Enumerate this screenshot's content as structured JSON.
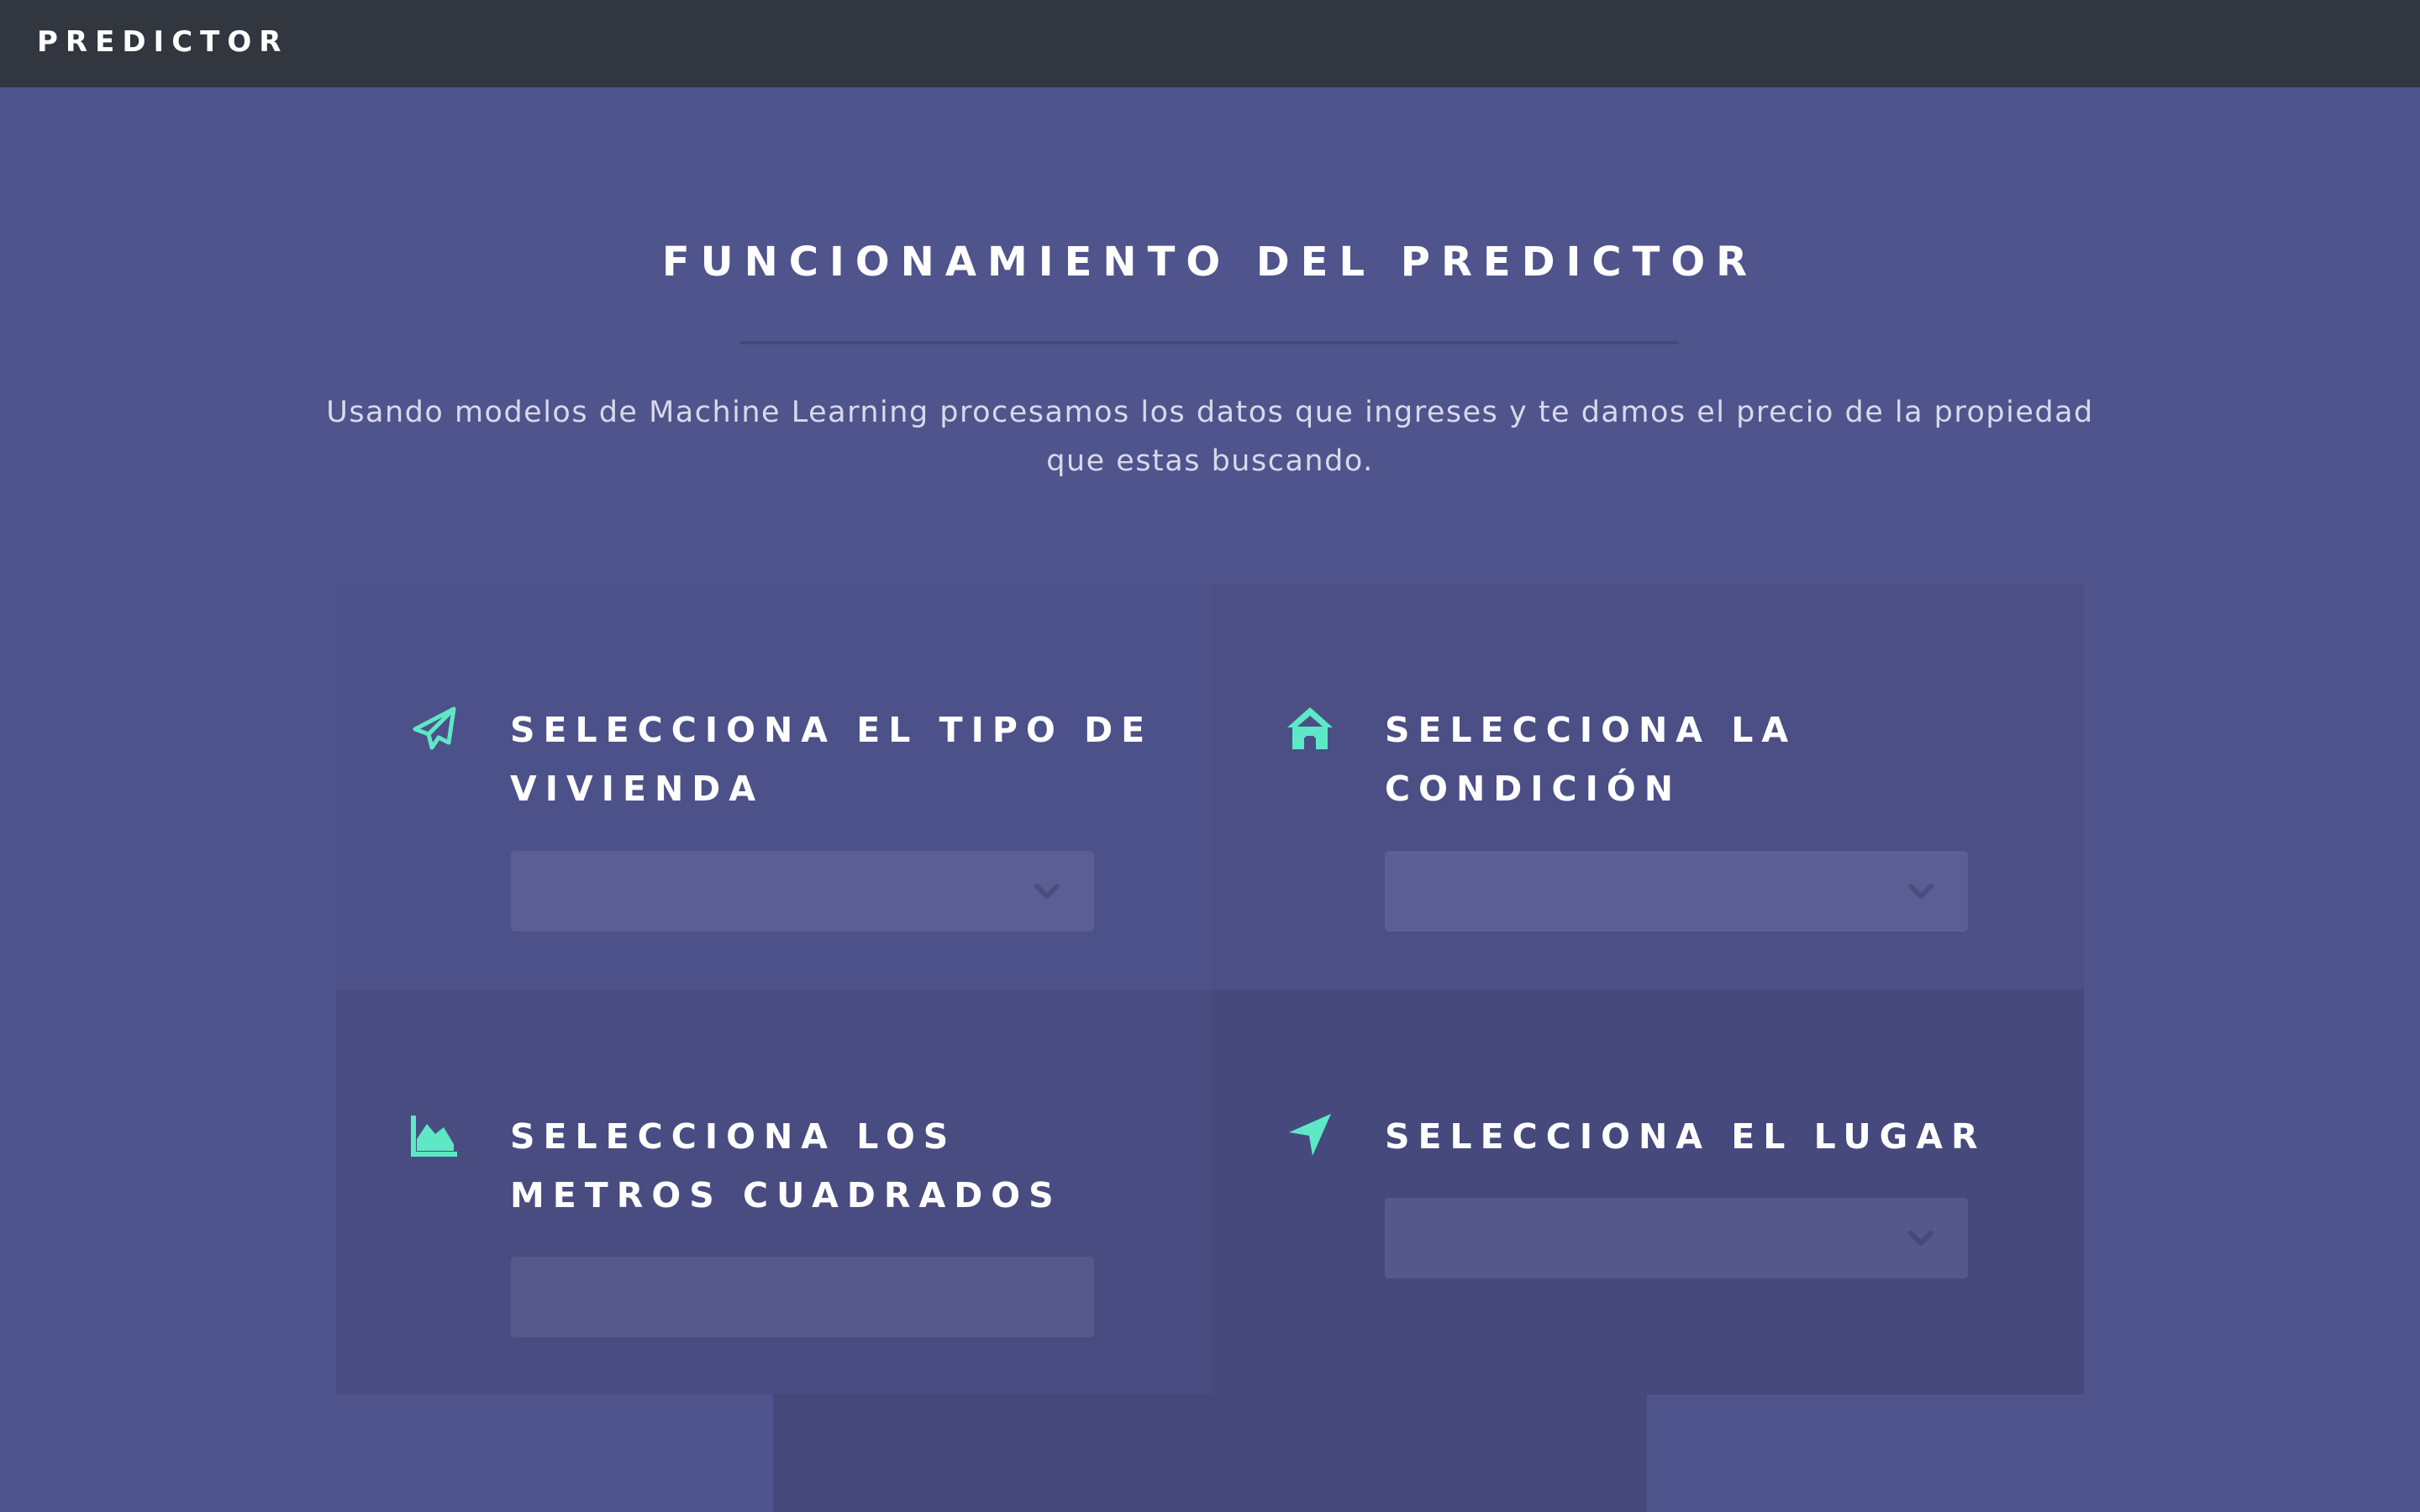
{
  "navbar": {
    "brand": "PREDICTOR"
  },
  "section": {
    "title": "FUNCIONAMIENTO DEL PREDICTOR",
    "intro_line1": "Usando modelos de Machine Learning procesamos los datos que ingreses y te damos el precio de la propiedad",
    "intro_line2": "que estas buscando."
  },
  "fields": {
    "tipo": {
      "heading_line1": "SELECCIONA EL TIPO DE",
      "heading_line2": "VIVIENDA",
      "icon": "paper-plane-icon",
      "value": ""
    },
    "condicion": {
      "heading_line1": "SELECCIONA LA",
      "heading_line2": "CONDICIÓN",
      "icon": "house-icon",
      "value": ""
    },
    "metros": {
      "heading_line1": "SELECCIONA LOS",
      "heading_line2": "METROS CUADRADOS",
      "icon": "area-chart-icon",
      "value": ""
    },
    "lugar": {
      "heading_line1": "SELECCIONA EL LUGAR",
      "icon": "location-arrow-icon",
      "value": ""
    }
  },
  "colors": {
    "accent": "#5ee8c6",
    "navbar": "#31363f",
    "background": "#4f548d"
  }
}
